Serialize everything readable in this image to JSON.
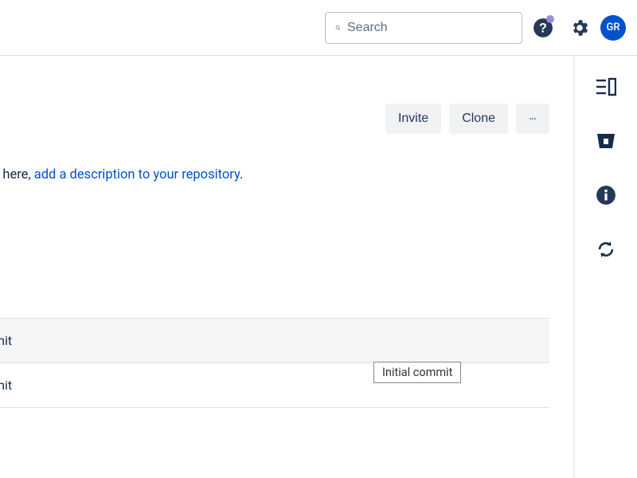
{
  "header": {
    "search": {
      "placeholder": "Search"
    },
    "avatar": "GR"
  },
  "actions": {
    "invite": "Invite",
    "clone": "Clone"
  },
  "description": {
    "prefix": "d here, ",
    "link": "add a description to your repository",
    "suffix": "."
  },
  "files": {
    "row1": "mit",
    "row2": "mit"
  },
  "tooltip": "Initial commit"
}
